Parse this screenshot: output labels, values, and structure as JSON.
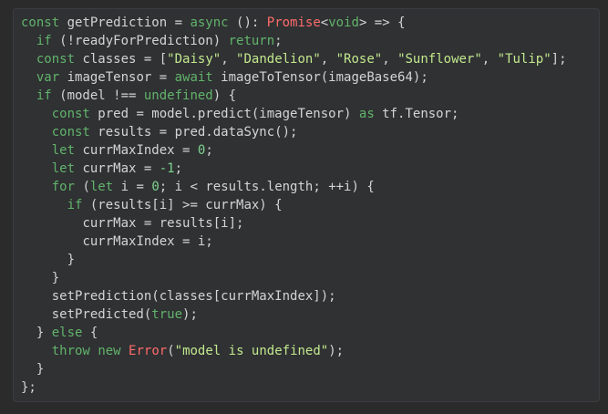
{
  "code": {
    "language": "typescript",
    "lines": [
      {
        "indent": "",
        "tokens": [
          {
            "t": "kw",
            "v": "const"
          },
          {
            "t": "plain",
            "v": " getPrediction = "
          },
          {
            "t": "kw",
            "v": "async"
          },
          {
            "t": "plain",
            "v": " (): "
          },
          {
            "t": "type",
            "v": "Promise"
          },
          {
            "t": "plain",
            "v": "<"
          },
          {
            "t": "kw",
            "v": "void"
          },
          {
            "t": "plain",
            "v": "> => {"
          }
        ]
      },
      {
        "indent": "  ",
        "tokens": [
          {
            "t": "kw",
            "v": "if"
          },
          {
            "t": "plain",
            "v": " (!readyForPrediction) "
          },
          {
            "t": "kw",
            "v": "return"
          },
          {
            "t": "plain",
            "v": ";"
          }
        ]
      },
      {
        "indent": "  ",
        "tokens": [
          {
            "t": "kw",
            "v": "const"
          },
          {
            "t": "plain",
            "v": " classes = ["
          },
          {
            "t": "str",
            "v": "\"Daisy\""
          },
          {
            "t": "plain",
            "v": ", "
          },
          {
            "t": "str",
            "v": "\"Dandelion\""
          },
          {
            "t": "plain",
            "v": ", "
          },
          {
            "t": "str",
            "v": "\"Rose\""
          },
          {
            "t": "plain",
            "v": ", "
          },
          {
            "t": "str",
            "v": "\"Sunflower\""
          },
          {
            "t": "plain",
            "v": ", "
          },
          {
            "t": "str",
            "v": "\"Tulip\""
          },
          {
            "t": "plain",
            "v": "];"
          }
        ]
      },
      {
        "indent": "  ",
        "tokens": [
          {
            "t": "kw",
            "v": "var"
          },
          {
            "t": "plain",
            "v": " imageTensor = "
          },
          {
            "t": "kw",
            "v": "await"
          },
          {
            "t": "plain",
            "v": " imageToTensor(imageBase64);"
          }
        ]
      },
      {
        "indent": "  ",
        "tokens": [
          {
            "t": "kw",
            "v": "if"
          },
          {
            "t": "plain",
            "v": " (model !== "
          },
          {
            "t": "kw",
            "v": "undefined"
          },
          {
            "t": "plain",
            "v": ") {"
          }
        ]
      },
      {
        "indent": "    ",
        "tokens": [
          {
            "t": "kw",
            "v": "const"
          },
          {
            "t": "plain",
            "v": " pred = model.predict(imageTensor) "
          },
          {
            "t": "kw",
            "v": "as"
          },
          {
            "t": "plain",
            "v": " tf.Tensor;"
          }
        ]
      },
      {
        "indent": "    ",
        "tokens": [
          {
            "t": "kw",
            "v": "const"
          },
          {
            "t": "plain",
            "v": " results = pred.dataSync();"
          }
        ]
      },
      {
        "indent": "    ",
        "tokens": [
          {
            "t": "kw",
            "v": "let"
          },
          {
            "t": "plain",
            "v": " currMaxIndex = "
          },
          {
            "t": "num",
            "v": "0"
          },
          {
            "t": "plain",
            "v": ";"
          }
        ]
      },
      {
        "indent": "    ",
        "tokens": [
          {
            "t": "kw",
            "v": "let"
          },
          {
            "t": "plain",
            "v": " currMax = "
          },
          {
            "t": "num",
            "v": "-1"
          },
          {
            "t": "plain",
            "v": ";"
          }
        ]
      },
      {
        "indent": "    ",
        "tokens": [
          {
            "t": "kw",
            "v": "for"
          },
          {
            "t": "plain",
            "v": " ("
          },
          {
            "t": "kw",
            "v": "let"
          },
          {
            "t": "plain",
            "v": " i = "
          },
          {
            "t": "num",
            "v": "0"
          },
          {
            "t": "plain",
            "v": "; i < results.length; ++i) {"
          }
        ]
      },
      {
        "indent": "      ",
        "tokens": [
          {
            "t": "kw",
            "v": "if"
          },
          {
            "t": "plain",
            "v": " (results[i] >= currMax) {"
          }
        ]
      },
      {
        "indent": "        ",
        "tokens": [
          {
            "t": "plain",
            "v": "currMax = results[i];"
          }
        ]
      },
      {
        "indent": "        ",
        "tokens": [
          {
            "t": "plain",
            "v": "currMaxIndex = i;"
          }
        ]
      },
      {
        "indent": "      ",
        "tokens": [
          {
            "t": "plain",
            "v": "}"
          }
        ]
      },
      {
        "indent": "    ",
        "tokens": [
          {
            "t": "plain",
            "v": "}"
          }
        ]
      },
      {
        "indent": "    ",
        "tokens": [
          {
            "t": "plain",
            "v": "setPrediction(classes[currMaxIndex]);"
          }
        ]
      },
      {
        "indent": "    ",
        "tokens": [
          {
            "t": "plain",
            "v": "setPredicted("
          },
          {
            "t": "kw",
            "v": "true"
          },
          {
            "t": "plain",
            "v": ");"
          }
        ]
      },
      {
        "indent": "  ",
        "tokens": [
          {
            "t": "plain",
            "v": "} "
          },
          {
            "t": "kw",
            "v": "else"
          },
          {
            "t": "plain",
            "v": " {"
          }
        ]
      },
      {
        "indent": "    ",
        "tokens": [
          {
            "t": "kw",
            "v": "throw"
          },
          {
            "t": "plain",
            "v": " "
          },
          {
            "t": "kw",
            "v": "new"
          },
          {
            "t": "plain",
            "v": " "
          },
          {
            "t": "type",
            "v": "Error"
          },
          {
            "t": "plain",
            "v": "("
          },
          {
            "t": "str",
            "v": "\"model is undefined\""
          },
          {
            "t": "plain",
            "v": ");"
          }
        ]
      },
      {
        "indent": "  ",
        "tokens": [
          {
            "t": "plain",
            "v": "}"
          }
        ]
      },
      {
        "indent": "",
        "tokens": [
          {
            "t": "plain",
            "v": "};"
          }
        ]
      }
    ]
  },
  "colors": {
    "background": "#2b2b2b",
    "panel": "#2f3133",
    "keyword": "#62b36b",
    "string": "#c3e88d",
    "type": "#ff6b6b",
    "plain": "#d4d4d4"
  }
}
